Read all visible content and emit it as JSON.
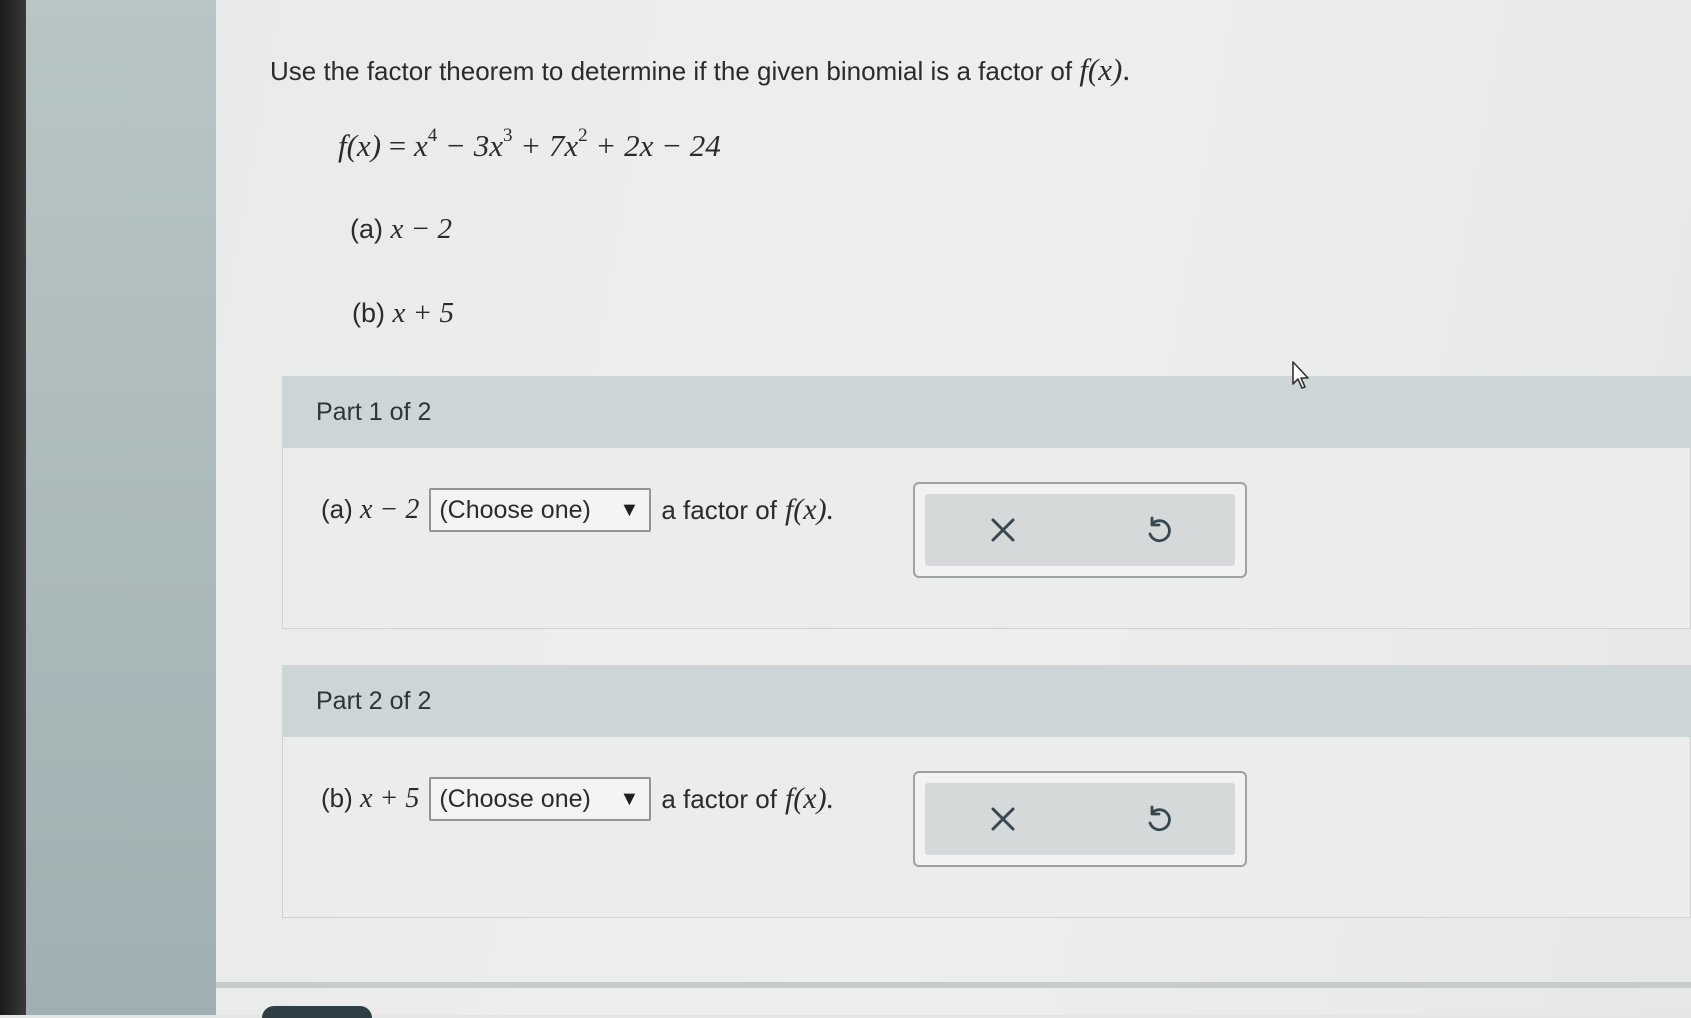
{
  "question": {
    "prompt": "Use the factor theorem to determine if the given binomial is a factor of",
    "fx": "f(x)",
    "formula": {
      "lhs": "f(x)",
      "parts": [
        {
          "text": "x",
          "sup": "4"
        },
        {
          "text": " − 3x",
          "sup": "3"
        },
        {
          "text": " + 7x",
          "sup": "2"
        },
        {
          "text": " + 2x − 24",
          "sup": ""
        }
      ]
    },
    "items": [
      {
        "label": "(a)",
        "expr": "x − 2"
      },
      {
        "label": "(b)",
        "expr": "x + 5"
      }
    ]
  },
  "parts": [
    {
      "header": "Part 1 of 2",
      "label": "(a)",
      "expr": "x − 2",
      "select_value": "(Choose one)",
      "suffix": "a factor of",
      "fx": "f(x)."
    },
    {
      "header": "Part 2 of 2",
      "label": "(b)",
      "expr": "x + 5",
      "select_value": "(Choose one)",
      "suffix": "a factor of",
      "fx": "f(x)."
    }
  ],
  "icons": {
    "clear": "close-icon",
    "undo": "undo-icon"
  },
  "colors": {
    "part_header_bg": "#cdd5d6",
    "icon_color": "#37474f"
  }
}
